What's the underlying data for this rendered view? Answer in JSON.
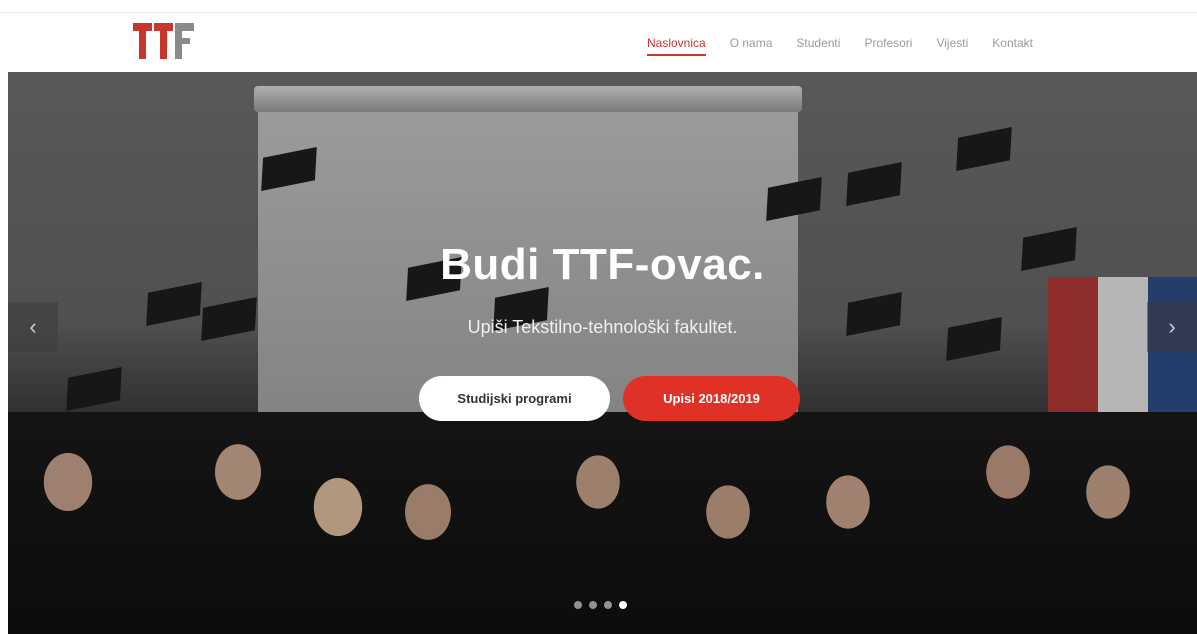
{
  "nav": {
    "logo_text": "TTF",
    "items": [
      {
        "label": "Naslovnica",
        "active": true
      },
      {
        "label": "O nama",
        "active": false
      },
      {
        "label": "Studenti",
        "active": false
      },
      {
        "label": "Profesori",
        "active": false
      },
      {
        "label": "Vijesti",
        "active": false
      },
      {
        "label": "Kontakt",
        "active": false
      }
    ]
  },
  "hero": {
    "title": "Budi TTF-ovac.",
    "subtitle": "Upiši Tekstilno-tehnološki fakultet.",
    "buttons": {
      "primary_label": "Studijski programi",
      "secondary_label": "Upisi 2018/2019"
    },
    "arrows": {
      "prev_icon": "chevron-left-icon",
      "next_icon": "chevron-right-icon"
    },
    "slides": {
      "count": 4,
      "active_index": 3
    }
  },
  "colors": {
    "accent": "#c8372f",
    "button_red": "#e03126",
    "menu_text": "#9a9a9a"
  }
}
